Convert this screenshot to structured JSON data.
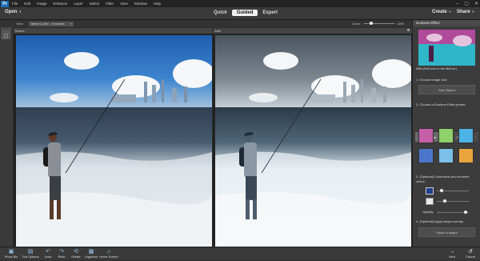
{
  "menubar": {
    "logo": "Pr",
    "items": [
      "File",
      "Edit",
      "Image",
      "Enhance",
      "Layer",
      "Select",
      "Filter",
      "View",
      "Window",
      "Help"
    ],
    "window_controls": [
      "–",
      "▢",
      "✕"
    ]
  },
  "modebar": {
    "open_label": "Open",
    "modes": [
      "Quick",
      "Guided",
      "Expert"
    ],
    "active_mode": "Guided",
    "create_label": "Create",
    "share_label": "Share"
  },
  "options": {
    "view_label": "View:",
    "view_value": "Before & After - Horizontal",
    "zoom_label": "Zoom:",
    "zoom_value": "42%"
  },
  "panes": {
    "before_title": "Before",
    "after_title": "After"
  },
  "side": {
    "title": "Duotone Effect",
    "after_caption": "After (Roll over to see Before.)",
    "step1": "1. Choose image size.",
    "size_option": "Size Option",
    "step2": "2. Choose a Duotone Effect preset.",
    "tab_normal": "Normal",
    "tab_gradient": "Gradient",
    "step3": "3. (Optional) Customize your duotone colors.",
    "opacity_label": "Opacity",
    "step4": "4. (Optional) Apply shape overlay.",
    "select_shape": "Select a shape",
    "preset_colors": [
      "#c55fa8",
      "#8fd16a",
      "#4db3e6",
      "#4b76c9",
      "#7ac0e8",
      "#e9a43b"
    ],
    "accent": "#1e6fb8"
  },
  "bottombar": {
    "items": [
      {
        "label": "Photo Bin",
        "icon": "photo-bin-icon"
      },
      {
        "label": "Tool Options",
        "icon": "tool-options-icon"
      },
      {
        "label": "Undo",
        "icon": "undo-icon"
      },
      {
        "label": "Redo",
        "icon": "redo-icon"
      },
      {
        "label": "Rotate",
        "icon": "rotate-icon"
      },
      {
        "label": "Organizer",
        "icon": "organizer-icon"
      },
      {
        "label": "Home Screen",
        "icon": "home-icon"
      }
    ],
    "next_label": "Next",
    "cancel_label": "Cancel"
  }
}
